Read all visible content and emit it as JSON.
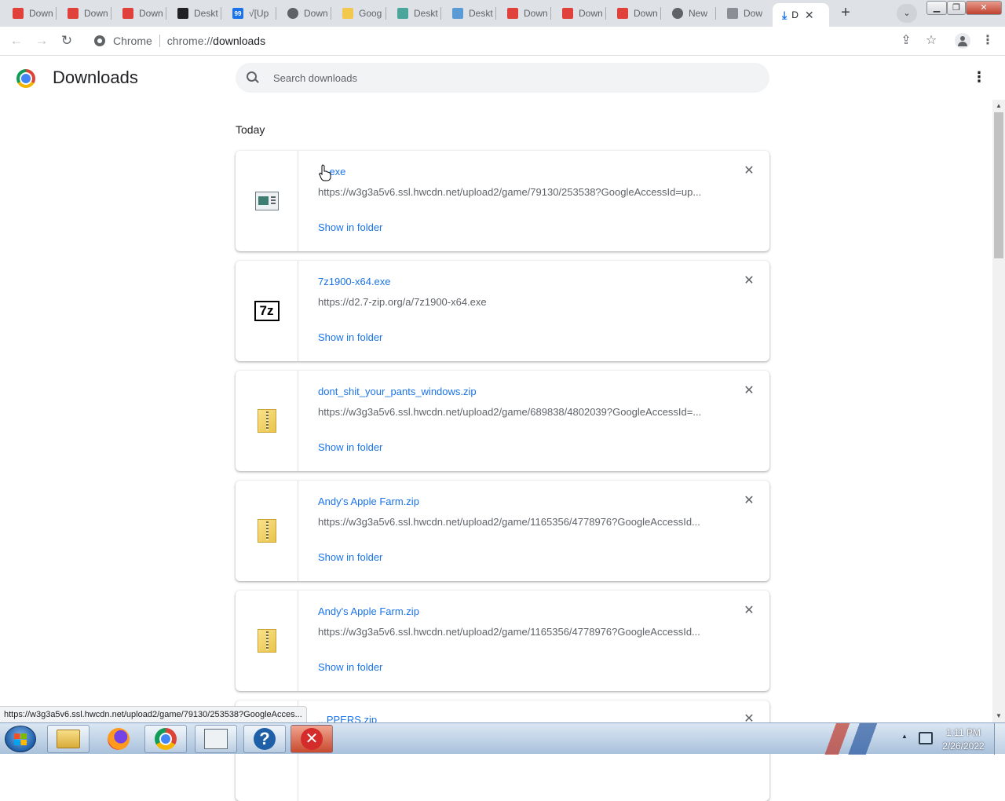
{
  "tabs": [
    {
      "title": "Down",
      "favicon": "itchio-icon",
      "color": "#e0423b"
    },
    {
      "title": "Down",
      "favicon": "itchio-icon",
      "color": "#e0423b"
    },
    {
      "title": "Down",
      "favicon": "itchio-icon",
      "color": "#e0423b"
    },
    {
      "title": "Deskt",
      "favicon": "terminal-icon",
      "color": "#202124"
    },
    {
      "title": "√[Up",
      "favicon": "99-icon",
      "color": "#1a73e8"
    },
    {
      "title": "Down",
      "favicon": "globe-icon",
      "color": "#5f6368"
    },
    {
      "title": "Goog",
      "favicon": "google-slides-icon",
      "color": "#f2c94c"
    },
    {
      "title": "Deskt",
      "favicon": "desktop-icon",
      "color": "#4aa59a"
    },
    {
      "title": "Deskt",
      "favicon": "desktop-icon",
      "color": "#5b9bd5"
    },
    {
      "title": "Down",
      "favicon": "itchio-icon",
      "color": "#e0423b"
    },
    {
      "title": "Down",
      "favicon": "itchio-icon",
      "color": "#e0423b"
    },
    {
      "title": "Down",
      "favicon": "itchio-icon",
      "color": "#e0423b"
    },
    {
      "title": "New",
      "favicon": "chrome-icon",
      "color": "#5f6368"
    },
    {
      "title": "Dow",
      "favicon": "document-icon",
      "color": "#8b8f95"
    },
    {
      "title": "D",
      "favicon": "download-icon",
      "color": "#1a73e8",
      "active": true
    }
  ],
  "toolbar": {
    "origin": "Chrome",
    "url_scheme": "chrome://",
    "url_path": "downloads"
  },
  "page": {
    "title": "Downloads",
    "search_placeholder": "Search downloads",
    "date_header": "Today"
  },
  "downloads": [
    {
      "file_name": "....exe",
      "url": "https://w3g3a5v6.ssl.hwcdn.net/upload2/game/79130/253538?GoogleAccessId=up...",
      "action": "Show in folder",
      "icon": "exe-file-icon"
    },
    {
      "file_name": "7z1900-x64.exe",
      "url": "https://d2.7-zip.org/a/7z1900-x64.exe",
      "action": "Show in folder",
      "icon": "7zip-icon"
    },
    {
      "file_name": "dont_shit_your_pants_windows.zip",
      "url": "https://w3g3a5v6.ssl.hwcdn.net/upload2/game/689838/4802039?GoogleAccessId=...",
      "action": "Show in folder",
      "icon": "zip-folder-icon"
    },
    {
      "file_name": "Andy's Apple Farm.zip",
      "url": "https://w3g3a5v6.ssl.hwcdn.net/upload2/game/1165356/4778976?GoogleAccessId...",
      "action": "Show in folder",
      "icon": "zip-folder-icon"
    },
    {
      "file_name": "Andy's Apple Farm.zip",
      "url": "https://w3g3a5v6.ssl.hwcdn.net/upload2/game/1165356/4778976?GoogleAccessId...",
      "action": "Show in folder",
      "icon": "zip-folder-icon"
    },
    {
      "file_name": "...PPERS.zip",
      "icon": "zip-folder-icon"
    }
  ],
  "status_bubble": "https://w3g3a5v6.ssl.hwcdn.net/upload2/game/79130/253538?GoogleAcces...",
  "taskbar": {
    "apps": [
      "windows-explorer-icon",
      "firefox-icon",
      "chrome-icon",
      "app-window-icon",
      "help-icon",
      "close-app-icon"
    ],
    "clock_time": "1:11 PM",
    "clock_date": "2/26/2022"
  },
  "colors": {
    "link_blue": "#1a73e8",
    "tabstrip_bg": "#dee1e6",
    "search_bg": "#f1f3f4"
  }
}
